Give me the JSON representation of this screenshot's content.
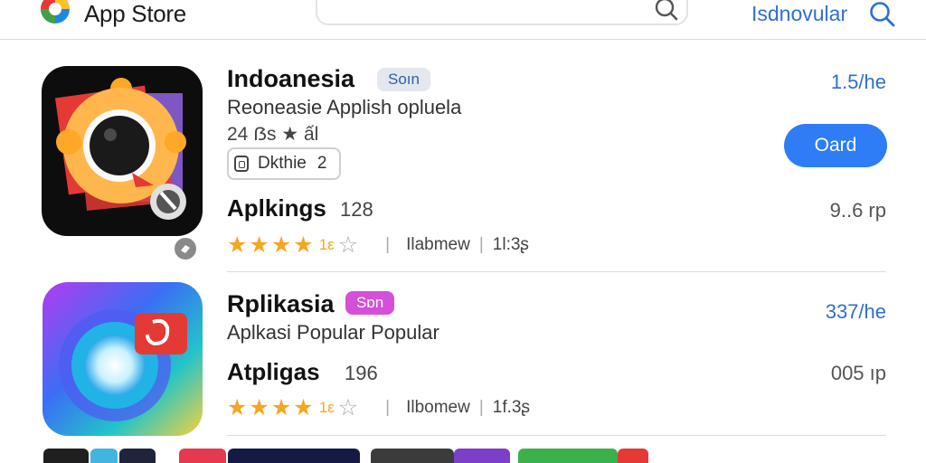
{
  "header": {
    "brand": "App Store",
    "search": {
      "placeholder": ""
    },
    "link_label": "Isdnovular",
    "logo_icon": "app-store-logo-icon",
    "search_icon": "search-icon"
  },
  "apps": [
    {
      "title": "Indoanesia",
      "tag": "Soın",
      "subtitle": "Reoneasie Applish opluela",
      "meta": "24 ẞs ★ ấl",
      "price": "1.5/he",
      "developer_label": "Dkthie",
      "developer_count": "2",
      "get_label": "Oard",
      "icon": "camera-lens-app-icon",
      "sub_title": "Aplkings",
      "sub_count": "128",
      "sub_price": "9..6 rp",
      "rating_text": "1ε",
      "col2": "Ilabmew",
      "col3": "1l:3ʂ",
      "rating": 4
    },
    {
      "title": "Rplikasia",
      "tag": "Sɒn",
      "subtitle": "Aplkasi Popular Popular",
      "price": "337/he",
      "icon": "camera-gradient-app-icon",
      "sub_title": "Atpligas",
      "sub_count": "196",
      "sub_price": "005 ıp",
      "rating_text": "1ε",
      "col2": "Ilbomew",
      "col3": "1f.3ʂ",
      "rating": 4
    }
  ],
  "colors": {
    "accent": "#2e7cf6",
    "link": "#2f6fcf",
    "tag1_bg": "#e4e7ee",
    "tag1_fg": "#2e5fa8",
    "tag2_bg": "#d64fd8",
    "star": "#f5a623"
  }
}
